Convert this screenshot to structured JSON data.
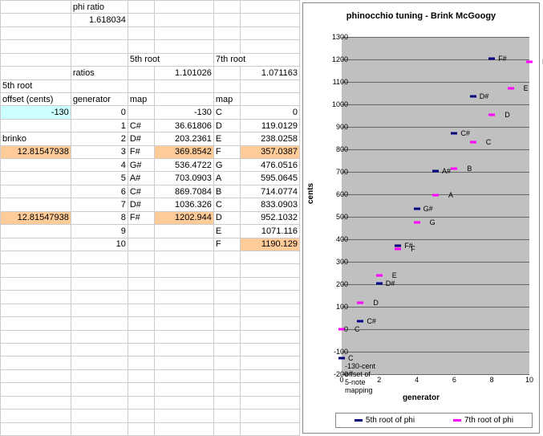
{
  "labels": {
    "phi_ratio": "phi ratio",
    "phi_val": "1.618034",
    "root5": "5th root",
    "root7": "7th root",
    "ratios": "ratios",
    "ratio5": "1.101026",
    "ratio7": "1.071163",
    "fifth_root": "5th root",
    "offset": "offset (cents)",
    "generator": "generator",
    "map": "map",
    "offset_val": "-130",
    "brinko": "brinko",
    "brinko_a": "12.81547938",
    "brinko_b": "12.81547938"
  },
  "rows": [
    {
      "g": "0",
      "m5": "",
      "v5": "-130",
      "m7": "C",
      "v7": "0"
    },
    {
      "g": "1",
      "m5": "C#",
      "v5": "36.61806",
      "m7": "D",
      "v7": "119.0129"
    },
    {
      "g": "2",
      "m5": "D#",
      "v5": "203.2361",
      "m7": "E",
      "v7": "238.0258"
    },
    {
      "g": "3",
      "m5": "F#",
      "v5": "369.8542",
      "m7": "F",
      "v7": "357.0387"
    },
    {
      "g": "4",
      "m5": "G#",
      "v5": "536.4722",
      "m7": "G",
      "v7": "476.0516"
    },
    {
      "g": "5",
      "m5": "A#",
      "v5": "703.0903",
      "m7": "A",
      "v7": "595.0645"
    },
    {
      "g": "6",
      "m5": "C#",
      "v5": "869.7084",
      "m7": "B",
      "v7": "714.0774"
    },
    {
      "g": "7",
      "m5": "D#",
      "v5": "1036.326",
      "m7": "C",
      "v7": "833.0903"
    },
    {
      "g": "8",
      "m5": "F#",
      "v5": "1202.944",
      "m7": "D",
      "v7": "952.1032"
    },
    {
      "g": "9",
      "m5": "",
      "v5": "",
      "m7": "E",
      "v7": "1071.116"
    },
    {
      "g": "10",
      "m5": "",
      "v5": "",
      "m7": "F",
      "v7": "1190.129"
    }
  ],
  "chart_data": {
    "type": "scatter",
    "title": "phinocchio tuning - Brink McGoogy",
    "xlabel": "generator",
    "ylabel": "cents",
    "xlim": [
      0,
      10
    ],
    "ylim": [
      -200,
      1300
    ],
    "xticks": [
      0,
      2,
      4,
      6,
      8,
      10
    ],
    "yticks": [
      -200,
      -100,
      0,
      100,
      200,
      300,
      400,
      500,
      600,
      700,
      800,
      900,
      1000,
      1100,
      1200,
      1300
    ],
    "series": [
      {
        "name": "5th root of phi",
        "color": "#000080",
        "x": [
          0,
          1,
          2,
          3,
          4,
          5,
          6,
          7,
          8
        ],
        "y": [
          -130,
          36.61806,
          203.2361,
          369.8542,
          536.4722,
          703.0903,
          869.7084,
          1036.326,
          1202.944
        ],
        "labels": [
          "C",
          "C#",
          "D#",
          "F#",
          "G#",
          "A#",
          "C#",
          "D#",
          "F#"
        ]
      },
      {
        "name": "7th root of phi",
        "color": "#ff00ff",
        "x": [
          0,
          1,
          2,
          3,
          4,
          5,
          6,
          7,
          8,
          9,
          10
        ],
        "y": [
          0,
          119.0129,
          238.0258,
          357.0387,
          476.0516,
          595.0645,
          714.0774,
          833.0903,
          952.1032,
          1071.116,
          1190.129
        ],
        "labels": [
          "C",
          "D",
          "E",
          "F",
          "G",
          "A",
          "B",
          "C",
          "D",
          "E",
          "F"
        ]
      }
    ],
    "annotations": [
      "-130-cent offset of 5-note mapping"
    ]
  }
}
